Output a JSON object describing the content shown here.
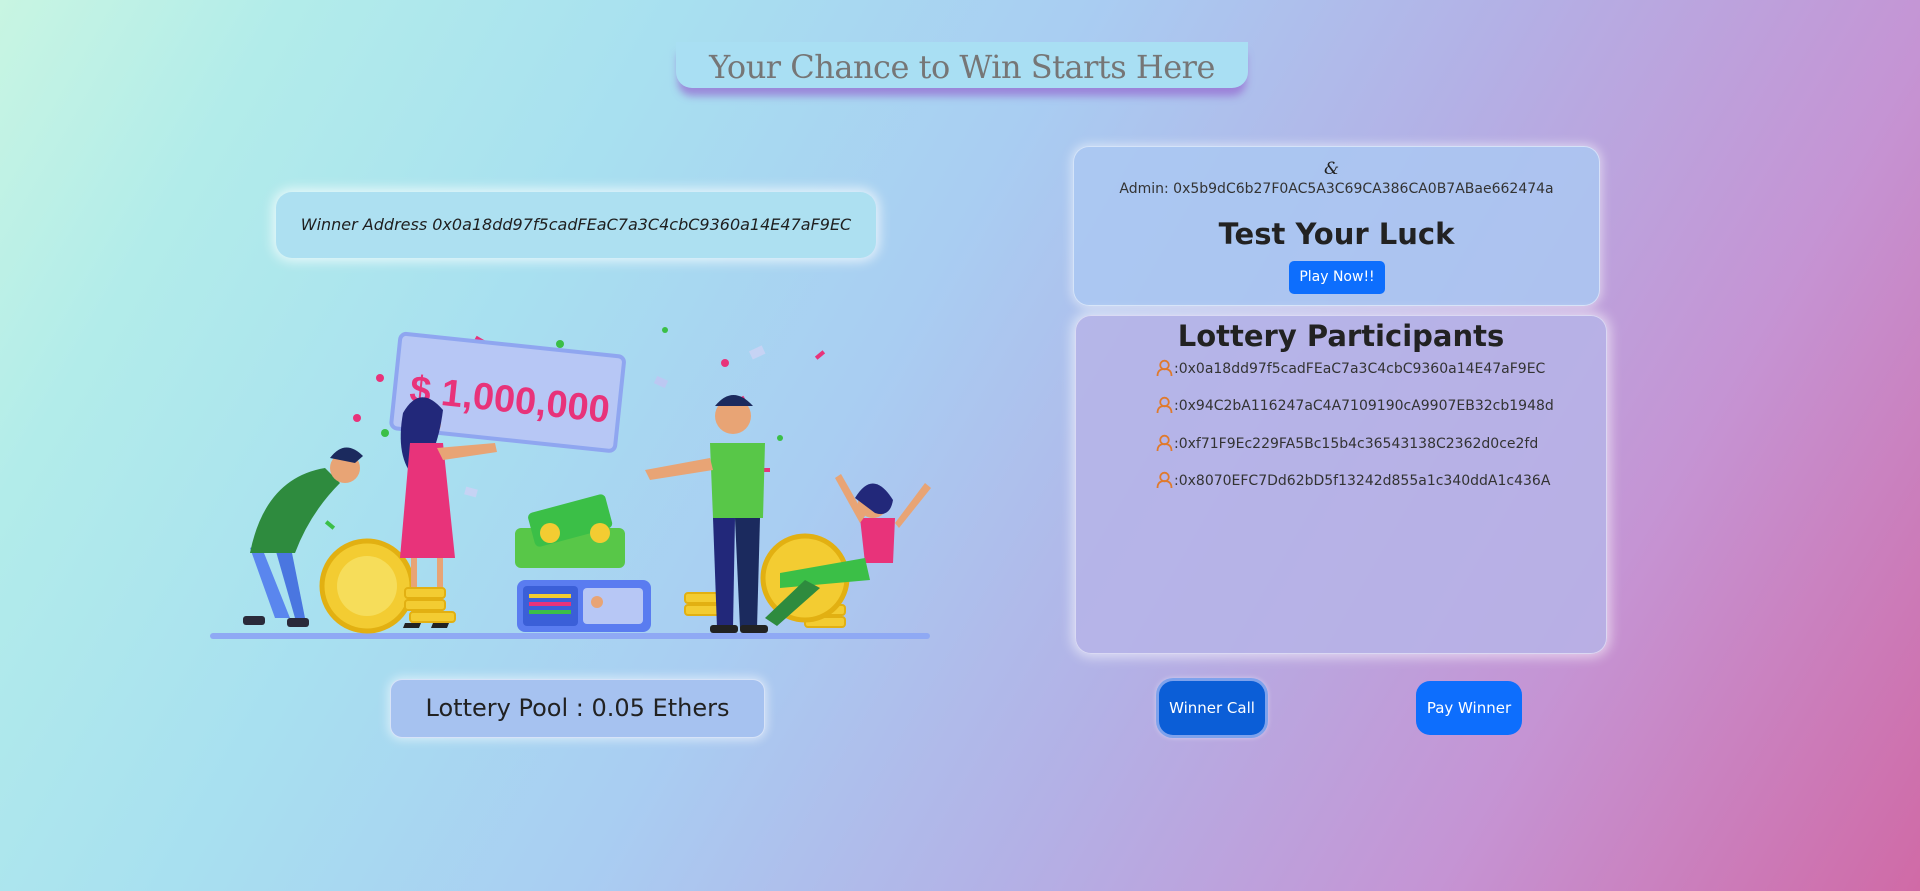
{
  "header": {
    "title": "Your Chance to Win Starts Here"
  },
  "winner": {
    "text": "Winner Address 0x0a18dd97f5cadFEaC7a3C4cbC9360a14E47aF9EC"
  },
  "illustration": {
    "cheque_amount": "$ 1,000,000"
  },
  "pool": {
    "text": "Lottery Pool : 0.05 Ethers"
  },
  "admin_card": {
    "icon": "&",
    "admin_text": "Admin: 0x5b9dC6b27F0AC5A3C69CA386CA0B7ABae662474a",
    "heading": "Test Your Luck",
    "play_button": "Play Now!!"
  },
  "participants": {
    "heading": "Lottery Participants",
    "icon": "person-icon",
    "list": [
      ":0x0a18dd97f5cadFEaC7a3C4cbC9360a14E47aF9EC",
      ":0x94C2bA116247aC4A7109190cA9907EB32cb1948d",
      ":0xf71F9Ec229FA5Bc15b4c36543138C2362d0ce2fd",
      ":0x8070EFC7Dd62bD5f13242d855a1c340ddA1c436A"
    ]
  },
  "actions": {
    "winner_call": "Winner Call",
    "pay_winner": "Pay Winner"
  },
  "colors": {
    "primary_button": "#0d6efd",
    "active_button": "#0b5ed7",
    "cheque_text": "#e8337a"
  }
}
